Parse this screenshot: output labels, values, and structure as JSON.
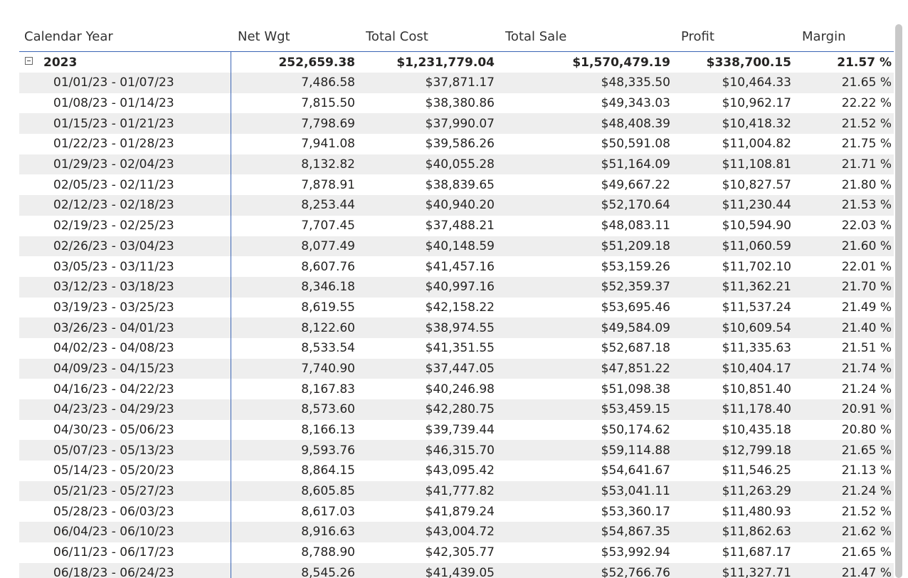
{
  "columns": {
    "year": "Calendar Year",
    "net_wgt": "Net Wgt",
    "total_cost": "Total Cost",
    "total_sale": "Total Sale",
    "profit": "Profit",
    "margin": "Margin"
  },
  "total_row": {
    "label": "2023",
    "net_wgt": "252,659.38",
    "total_cost": "$1,231,779.04",
    "total_sale": "$1,570,479.19",
    "profit": "$338,700.15",
    "margin": "21.57 %"
  },
  "rows": [
    {
      "label": "01/01/23 - 01/07/23",
      "net_wgt": "7,486.58",
      "total_cost": "$37,871.17",
      "total_sale": "$48,335.50",
      "profit": "$10,464.33",
      "margin": "21.65 %"
    },
    {
      "label": "01/08/23 - 01/14/23",
      "net_wgt": "7,815.50",
      "total_cost": "$38,380.86",
      "total_sale": "$49,343.03",
      "profit": "$10,962.17",
      "margin": "22.22 %"
    },
    {
      "label": "01/15/23 - 01/21/23",
      "net_wgt": "7,798.69",
      "total_cost": "$37,990.07",
      "total_sale": "$48,408.39",
      "profit": "$10,418.32",
      "margin": "21.52 %"
    },
    {
      "label": "01/22/23 - 01/28/23",
      "net_wgt": "7,941.08",
      "total_cost": "$39,586.26",
      "total_sale": "$50,591.08",
      "profit": "$11,004.82",
      "margin": "21.75 %"
    },
    {
      "label": "01/29/23 - 02/04/23",
      "net_wgt": "8,132.82",
      "total_cost": "$40,055.28",
      "total_sale": "$51,164.09",
      "profit": "$11,108.81",
      "margin": "21.71 %"
    },
    {
      "label": "02/05/23 - 02/11/23",
      "net_wgt": "7,878.91",
      "total_cost": "$38,839.65",
      "total_sale": "$49,667.22",
      "profit": "$10,827.57",
      "margin": "21.80 %"
    },
    {
      "label": "02/12/23 - 02/18/23",
      "net_wgt": "8,253.44",
      "total_cost": "$40,940.20",
      "total_sale": "$52,170.64",
      "profit": "$11,230.44",
      "margin": "21.53 %"
    },
    {
      "label": "02/19/23 - 02/25/23",
      "net_wgt": "7,707.45",
      "total_cost": "$37,488.21",
      "total_sale": "$48,083.11",
      "profit": "$10,594.90",
      "margin": "22.03 %"
    },
    {
      "label": "02/26/23 - 03/04/23",
      "net_wgt": "8,077.49",
      "total_cost": "$40,148.59",
      "total_sale": "$51,209.18",
      "profit": "$11,060.59",
      "margin": "21.60 %"
    },
    {
      "label": "03/05/23 - 03/11/23",
      "net_wgt": "8,607.76",
      "total_cost": "$41,457.16",
      "total_sale": "$53,159.26",
      "profit": "$11,702.10",
      "margin": "22.01 %"
    },
    {
      "label": "03/12/23 - 03/18/23",
      "net_wgt": "8,346.18",
      "total_cost": "$40,997.16",
      "total_sale": "$52,359.37",
      "profit": "$11,362.21",
      "margin": "21.70 %"
    },
    {
      "label": "03/19/23 - 03/25/23",
      "net_wgt": "8,619.55",
      "total_cost": "$42,158.22",
      "total_sale": "$53,695.46",
      "profit": "$11,537.24",
      "margin": "21.49 %"
    },
    {
      "label": "03/26/23 - 04/01/23",
      "net_wgt": "8,122.60",
      "total_cost": "$38,974.55",
      "total_sale": "$49,584.09",
      "profit": "$10,609.54",
      "margin": "21.40 %"
    },
    {
      "label": "04/02/23 - 04/08/23",
      "net_wgt": "8,533.54",
      "total_cost": "$41,351.55",
      "total_sale": "$52,687.18",
      "profit": "$11,335.63",
      "margin": "21.51 %"
    },
    {
      "label": "04/09/23 - 04/15/23",
      "net_wgt": "7,740.90",
      "total_cost": "$37,447.05",
      "total_sale": "$47,851.22",
      "profit": "$10,404.17",
      "margin": "21.74 %"
    },
    {
      "label": "04/16/23 - 04/22/23",
      "net_wgt": "8,167.83",
      "total_cost": "$40,246.98",
      "total_sale": "$51,098.38",
      "profit": "$10,851.40",
      "margin": "21.24 %"
    },
    {
      "label": "04/23/23 - 04/29/23",
      "net_wgt": "8,573.60",
      "total_cost": "$42,280.75",
      "total_sale": "$53,459.15",
      "profit": "$11,178.40",
      "margin": "20.91 %"
    },
    {
      "label": "04/30/23 - 05/06/23",
      "net_wgt": "8,166.13",
      "total_cost": "$39,739.44",
      "total_sale": "$50,174.62",
      "profit": "$10,435.18",
      "margin": "20.80 %"
    },
    {
      "label": "05/07/23 - 05/13/23",
      "net_wgt": "9,593.76",
      "total_cost": "$46,315.70",
      "total_sale": "$59,114.88",
      "profit": "$12,799.18",
      "margin": "21.65 %"
    },
    {
      "label": "05/14/23 - 05/20/23",
      "net_wgt": "8,864.15",
      "total_cost": "$43,095.42",
      "total_sale": "$54,641.67",
      "profit": "$11,546.25",
      "margin": "21.13 %"
    },
    {
      "label": "05/21/23 - 05/27/23",
      "net_wgt": "8,605.85",
      "total_cost": "$41,777.82",
      "total_sale": "$53,041.11",
      "profit": "$11,263.29",
      "margin": "21.24 %"
    },
    {
      "label": "05/28/23 - 06/03/23",
      "net_wgt": "8,617.03",
      "total_cost": "$41,879.24",
      "total_sale": "$53,360.17",
      "profit": "$11,480.93",
      "margin": "21.52 %"
    },
    {
      "label": "06/04/23 - 06/10/23",
      "net_wgt": "8,916.63",
      "total_cost": "$43,004.72",
      "total_sale": "$54,867.35",
      "profit": "$11,862.63",
      "margin": "21.62 %"
    },
    {
      "label": "06/11/23 - 06/17/23",
      "net_wgt": "8,788.90",
      "total_cost": "$42,305.77",
      "total_sale": "$53,992.94",
      "profit": "$11,687.17",
      "margin": "21.65 %"
    },
    {
      "label": "06/18/23 - 06/24/23",
      "net_wgt": "8,545.26",
      "total_cost": "$41,439.05",
      "total_sale": "$52,766.76",
      "profit": "$11,327.71",
      "margin": "21.47 %"
    }
  ],
  "colors": {
    "accent_line": "#3a64b4",
    "row_shade": "#eeeeee",
    "scrollbar": "#c8c8c8"
  }
}
